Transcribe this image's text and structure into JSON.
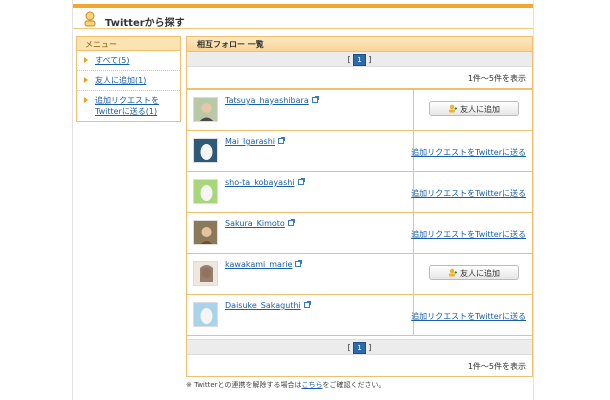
{
  "header": {
    "title": "Twitterから探す",
    "icon": "user-search-icon"
  },
  "sidebar": {
    "title": "メニュー",
    "items": [
      {
        "label": "すべて(5)"
      },
      {
        "label": "友人に追加(1)"
      },
      {
        "label": "追加リクエストを\nTwitterに送る(1)"
      }
    ]
  },
  "main": {
    "title": "相互フォロー 一覧",
    "pager": {
      "current": "1",
      "left_bracket": "[",
      "right_bracket": "]"
    },
    "count_text": "1件～5件を表示",
    "rows": [
      {
        "name": "Tatsuya_hayashibara",
        "action": "友人に追加",
        "action_type": "button",
        "avatar": "photo"
      },
      {
        "name": "Mai_Igarashi",
        "action": "追加リクエストをTwitterに送る",
        "action_type": "link",
        "avatar": "egg-blue"
      },
      {
        "name": "sho-ta_kobayashi",
        "action": "追加リクエストをTwitterに送る",
        "action_type": "link",
        "avatar": "egg-green"
      },
      {
        "name": "Sakura_Kimoto",
        "action": "追加リクエストをTwitterに送る",
        "action_type": "link",
        "avatar": "photo"
      },
      {
        "name": "kawakami_marie",
        "action": "友人に追加",
        "action_type": "button",
        "avatar": "photo"
      },
      {
        "name": "Daisuke_Sakaguthi",
        "action": "追加リクエストをTwitterに送る",
        "action_type": "link",
        "avatar": "egg-lightblue"
      }
    ]
  },
  "footer": {
    "note_prefix": "※ Twitterとの連携を解除する場合は",
    "note_link": "こちら",
    "note_suffix": "をご確認ください。"
  },
  "colors": {
    "accent": "#f0a830",
    "link": "#1a5fa8",
    "border": "#f0c070"
  }
}
